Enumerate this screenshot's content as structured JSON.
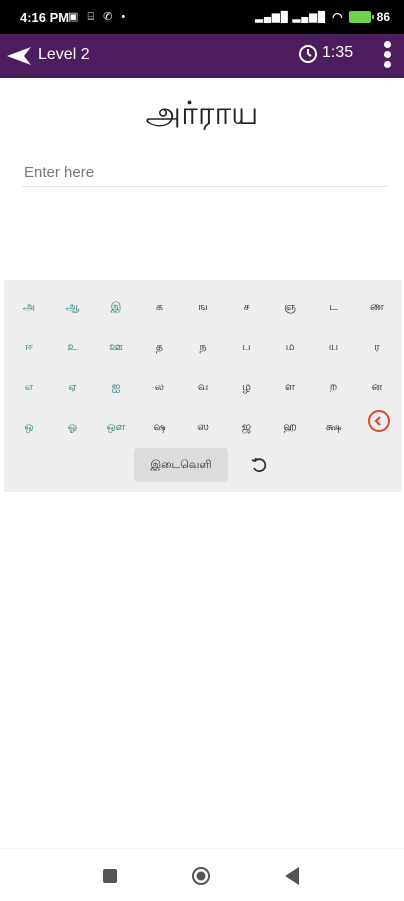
{
  "status_bar": {
    "time": "4:16 PM",
    "icons": "▣ ⌸ ✆ •",
    "battery": "86"
  },
  "app_bar": {
    "title": "Level 2",
    "timer": "1:35"
  },
  "word": "அர்ராய",
  "input": {
    "placeholder": "Enter here",
    "value": ""
  },
  "keyboard": {
    "rows": [
      [
        {
          "label": "அ",
          "vowel": true
        },
        {
          "label": "ஆ",
          "vowel": true
        },
        {
          "label": "இ",
          "vowel": true
        },
        {
          "label": "க",
          "vowel": false
        },
        {
          "label": "ங",
          "vowel": false
        },
        {
          "label": "ச",
          "vowel": false
        },
        {
          "label": "ஞ",
          "vowel": false
        },
        {
          "label": "ட",
          "vowel": false
        },
        {
          "label": "ண",
          "vowel": false
        }
      ],
      [
        {
          "label": "ஈ",
          "vowel": true
        },
        {
          "label": "உ",
          "vowel": true
        },
        {
          "label": "ஊ",
          "vowel": true
        },
        {
          "label": "த",
          "vowel": false
        },
        {
          "label": "ந",
          "vowel": false
        },
        {
          "label": "ப",
          "vowel": false
        },
        {
          "label": "ம",
          "vowel": false
        },
        {
          "label": "ய",
          "vowel": false
        },
        {
          "label": "ர",
          "vowel": false
        }
      ],
      [
        {
          "label": "எ",
          "vowel": true
        },
        {
          "label": "ஏ",
          "vowel": true
        },
        {
          "label": "ஐ",
          "vowel": true
        },
        {
          "label": "ல",
          "vowel": false
        },
        {
          "label": "வ",
          "vowel": false
        },
        {
          "label": "ழ",
          "vowel": false
        },
        {
          "label": "ள",
          "vowel": false
        },
        {
          "label": "ற",
          "vowel": false
        },
        {
          "label": "ன",
          "vowel": false
        }
      ],
      [
        {
          "label": "ஒ",
          "vowel": true
        },
        {
          "label": "ஓ",
          "vowel": true
        },
        {
          "label": "ஔ",
          "vowel": true
        },
        {
          "label": "ஷ",
          "vowel": false
        },
        {
          "label": "ஸ",
          "vowel": false
        },
        {
          "label": "ஜ",
          "vowel": false
        },
        {
          "label": "ஹ",
          "vowel": false
        },
        {
          "label": "க்ஷ",
          "vowel": false
        }
      ]
    ],
    "space_label": "இடைவெளி",
    "backspace_icon": "chevron-left-circle-icon",
    "undo_icon": "undo-icon"
  },
  "colors": {
    "app_bar": "#4e1d5e",
    "vowel_key": "#1a7a73",
    "backspace": "#e04a28"
  }
}
